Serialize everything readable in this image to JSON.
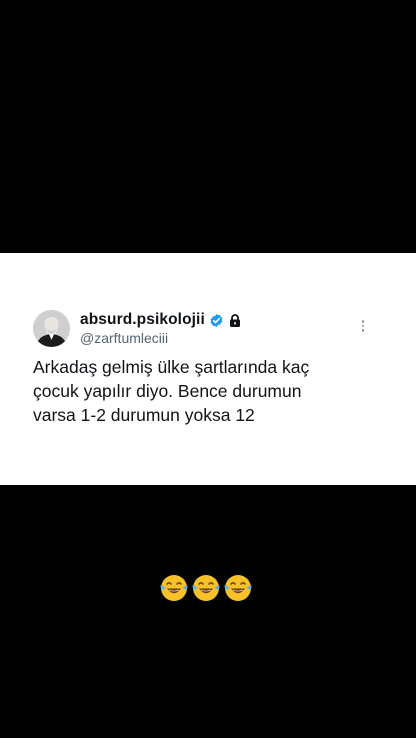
{
  "tweet": {
    "author_name": "absurd.psikolojii",
    "handle": "@zarftumleciii",
    "text_lines": [
      "Arkadaş gelmiş ülke şartlarında kaç",
      "çocuk yapılır diyo. Bence durumun",
      "varsa 1-2 durumun yoksa 12"
    ],
    "badges": [
      "verified-icon",
      "lock-icon"
    ],
    "menu_icon": "more-options-icon"
  },
  "caption": {
    "emojis": [
      "😂",
      "😂",
      "😂"
    ]
  },
  "colors": {
    "background": "#000000",
    "card": "#ffffff",
    "text": "#0f1419",
    "secondary_text": "#536471",
    "verified": "#1d9bf0"
  }
}
